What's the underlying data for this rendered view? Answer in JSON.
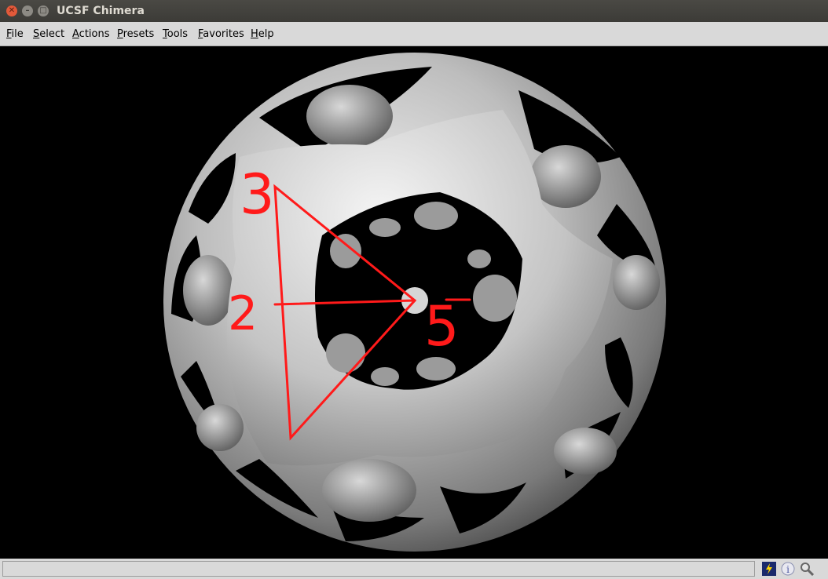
{
  "window": {
    "title": "UCSF Chimera"
  },
  "menubar": {
    "items": [
      "File",
      "Select",
      "Actions",
      "Presets",
      "Tools",
      "Favorites",
      "Help"
    ]
  },
  "annotations": {
    "labels": [
      "3",
      "2",
      "5"
    ],
    "color": "#ff1a1a"
  },
  "status": {
    "message": ""
  },
  "status_icons": [
    "command-line-icon",
    "info-icon",
    "zoom-icon"
  ],
  "colors": {
    "background": "#000000",
    "surface": "#c9c9c9",
    "annotation": "#ff1a1a"
  }
}
